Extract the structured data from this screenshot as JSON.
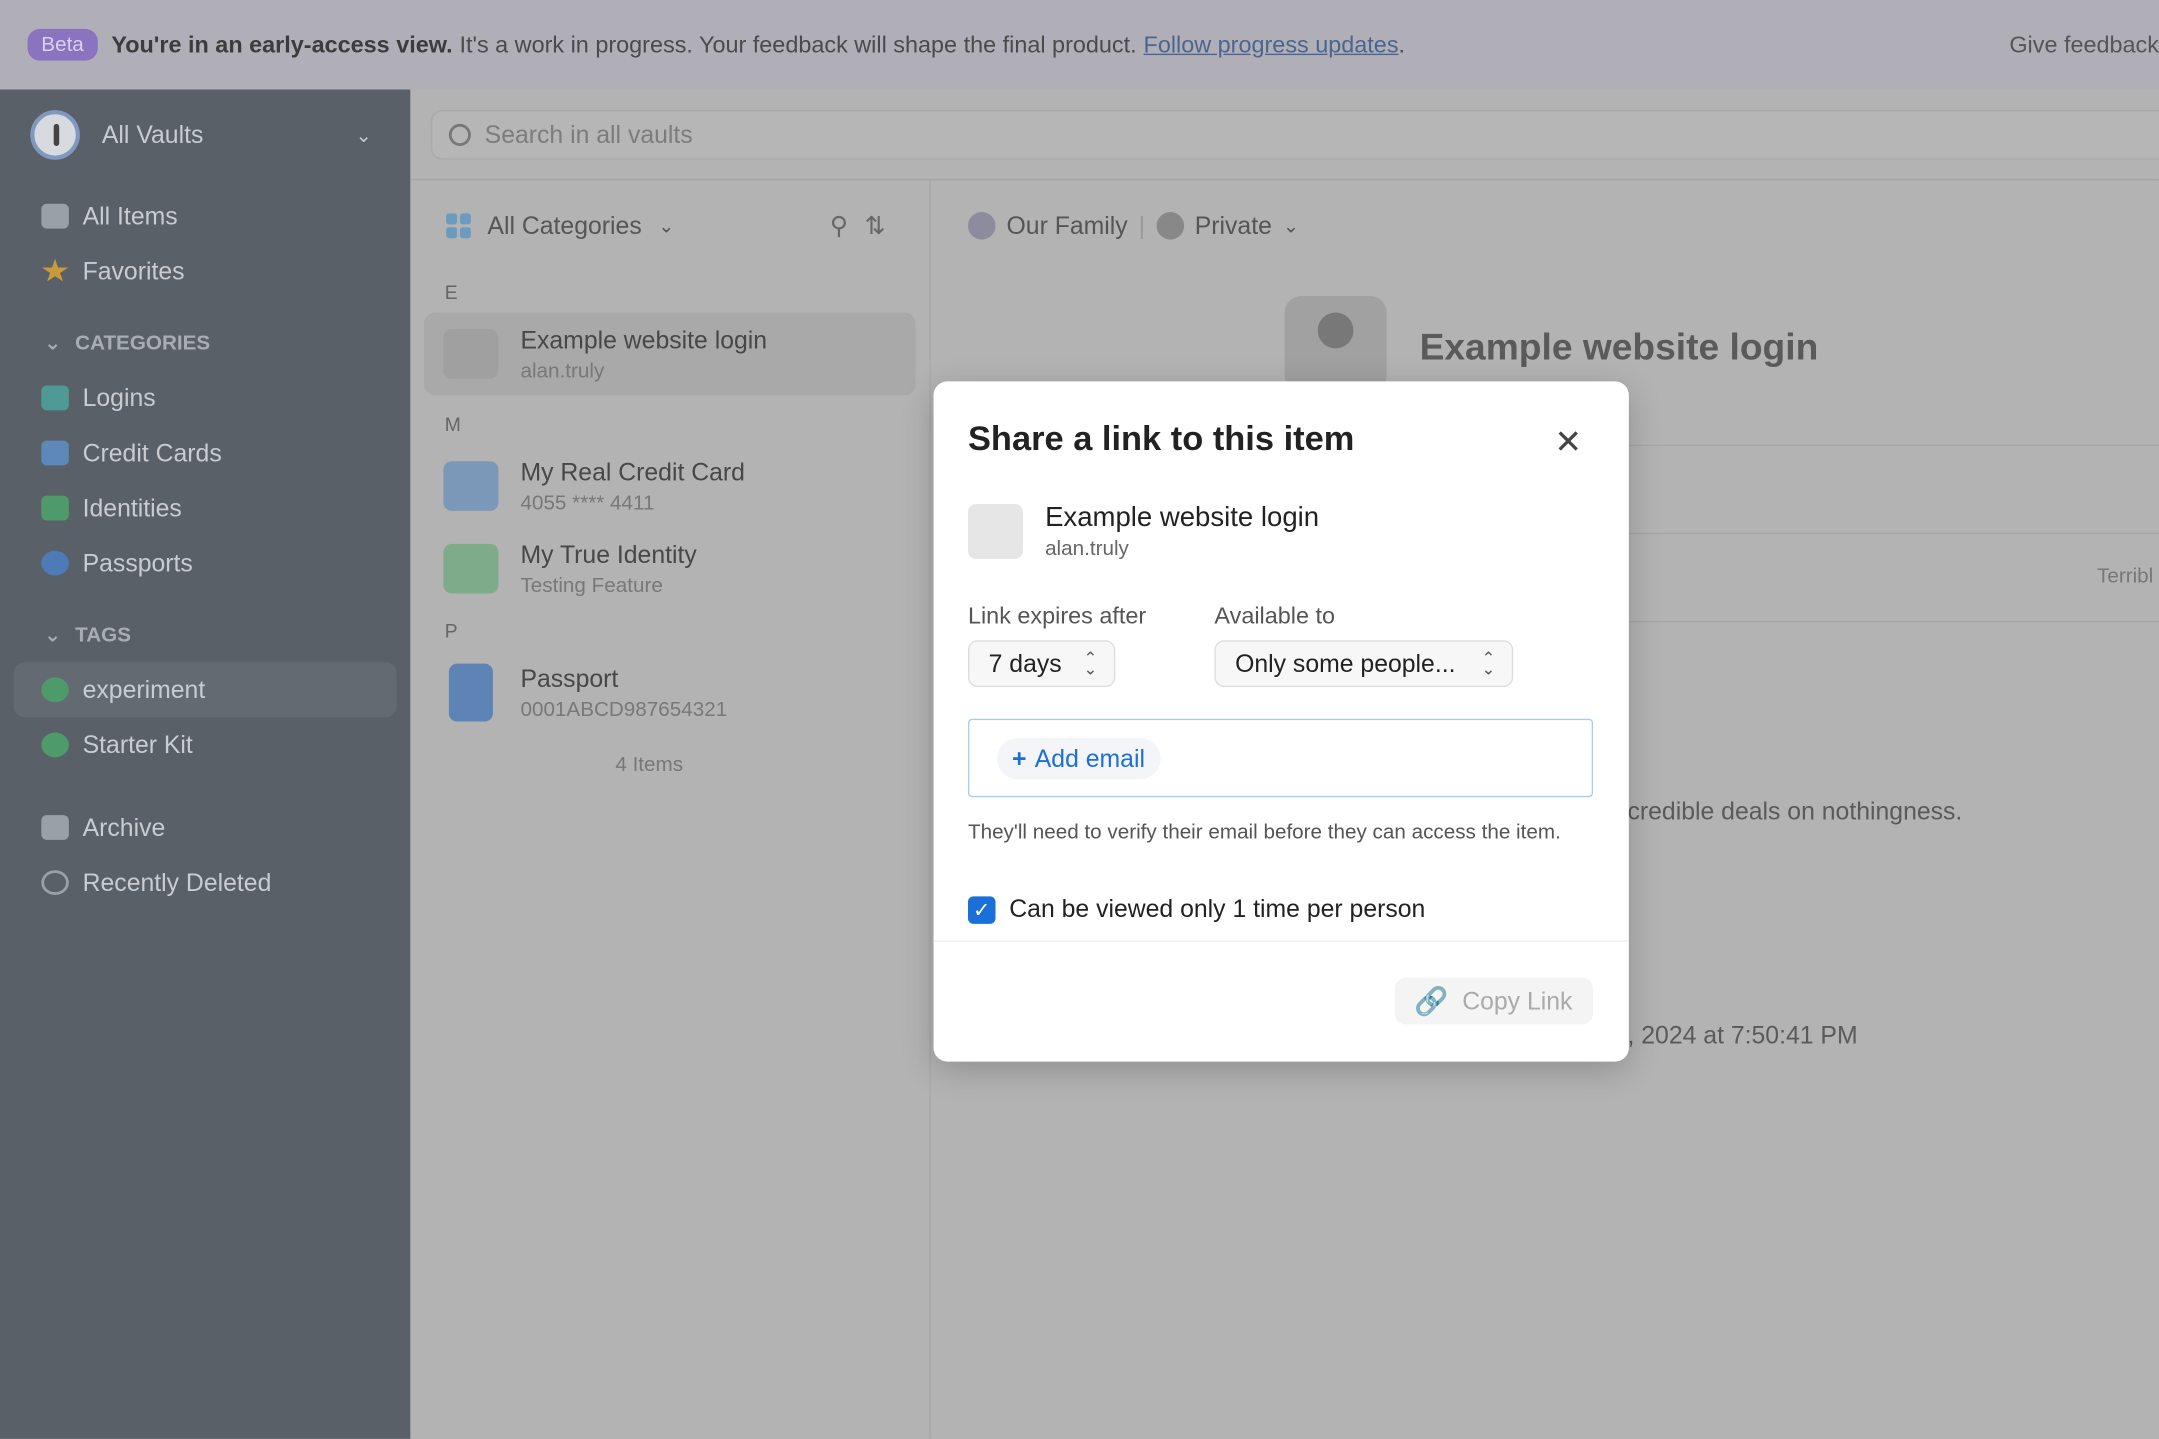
{
  "banner": {
    "badge": "Beta",
    "bold": "You're in an early-access view.",
    "text": "It's a work in progress. Your feedback will shape the final product.",
    "link": "Follow progress updates",
    "after": ".",
    "feedback": "Give feedback"
  },
  "sidebar": {
    "vault": "All Vaults",
    "items": [
      {
        "label": "All Items"
      },
      {
        "label": "Favorites"
      }
    ],
    "categories_header": "CATEGORIES",
    "categories": [
      {
        "label": "Logins"
      },
      {
        "label": "Credit Cards"
      },
      {
        "label": "Identities"
      },
      {
        "label": "Passports"
      }
    ],
    "tags_header": "TAGS",
    "tags": [
      {
        "label": "experiment"
      },
      {
        "label": "Starter Kit"
      }
    ],
    "bottom": [
      {
        "label": "Archive"
      },
      {
        "label": "Recently Deleted"
      }
    ]
  },
  "search": {
    "placeholder": "Search in all vaults"
  },
  "list": {
    "filter": "All Categories",
    "groups": [
      {
        "letter": "E",
        "items": [
          {
            "title": "Example website login",
            "sub": "alan.truly"
          }
        ]
      },
      {
        "letter": "M",
        "items": [
          {
            "title": "My Real Credit Card",
            "sub": "4055 **** 4411"
          },
          {
            "title": "My True Identity",
            "sub": "Testing Feature"
          }
        ]
      },
      {
        "letter": "P",
        "items": [
          {
            "title": "Passport",
            "sub": "0001ABCD987654321"
          }
        ]
      }
    ],
    "count": "4 Items"
  },
  "detail": {
    "vault": "Our Family",
    "vault2": "Private",
    "title": "Example website login",
    "strength": "Terribl",
    "notes": "credible deals on nothingness.",
    "date": ", 2024 at 7:50:41 PM"
  },
  "modal": {
    "title": "Share a link to this item",
    "item_title": "Example website login",
    "item_sub": "alan.truly",
    "expires_label": "Link expires after",
    "expires_value": "7 days",
    "available_label": "Available to",
    "available_value": "Only some people...",
    "add_email": "Add email",
    "hint": "They'll need to verify their email before they can access the item.",
    "checkbox_label": "Can be viewed only 1 time per person",
    "checkbox_checked": true,
    "copy": "Copy Link"
  },
  "colors": {
    "accent": "#1b6fd8",
    "beta": "#8a74c0"
  }
}
